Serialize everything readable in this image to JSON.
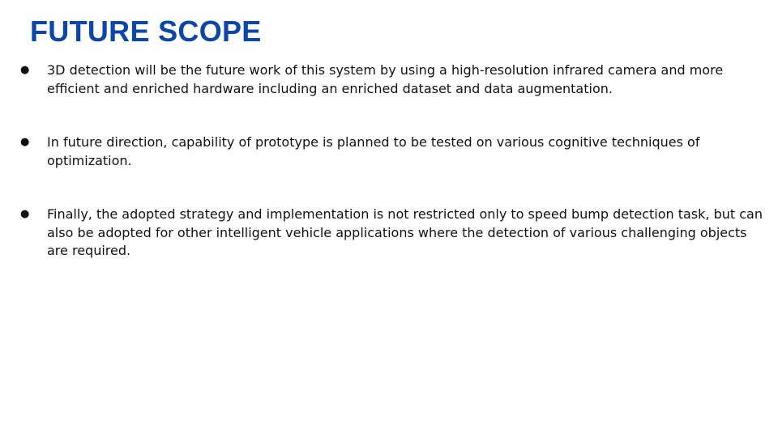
{
  "slide": {
    "title": "FUTURE SCOPE",
    "bullets": [
      {
        "marker": "●",
        "text": "3D detection will be the future work of this system by using a high-resolution infrared camera and more efficient and enriched hardware including an enriched dataset and data augmentation."
      },
      {
        "marker": "●",
        "text": "In future direction, capability of prototype is planned to be tested on various cognitive techniques of optimization."
      },
      {
        "marker": "●",
        "text": "Finally, the adopted strategy and implementation is not restricted only to speed bump detection task, but can also be adopted for other intelligent vehicle applications where the detection of various challenging objects are required."
      }
    ]
  },
  "colors": {
    "title": "#0b46a8",
    "text": "#111111",
    "background": "#ffffff"
  }
}
